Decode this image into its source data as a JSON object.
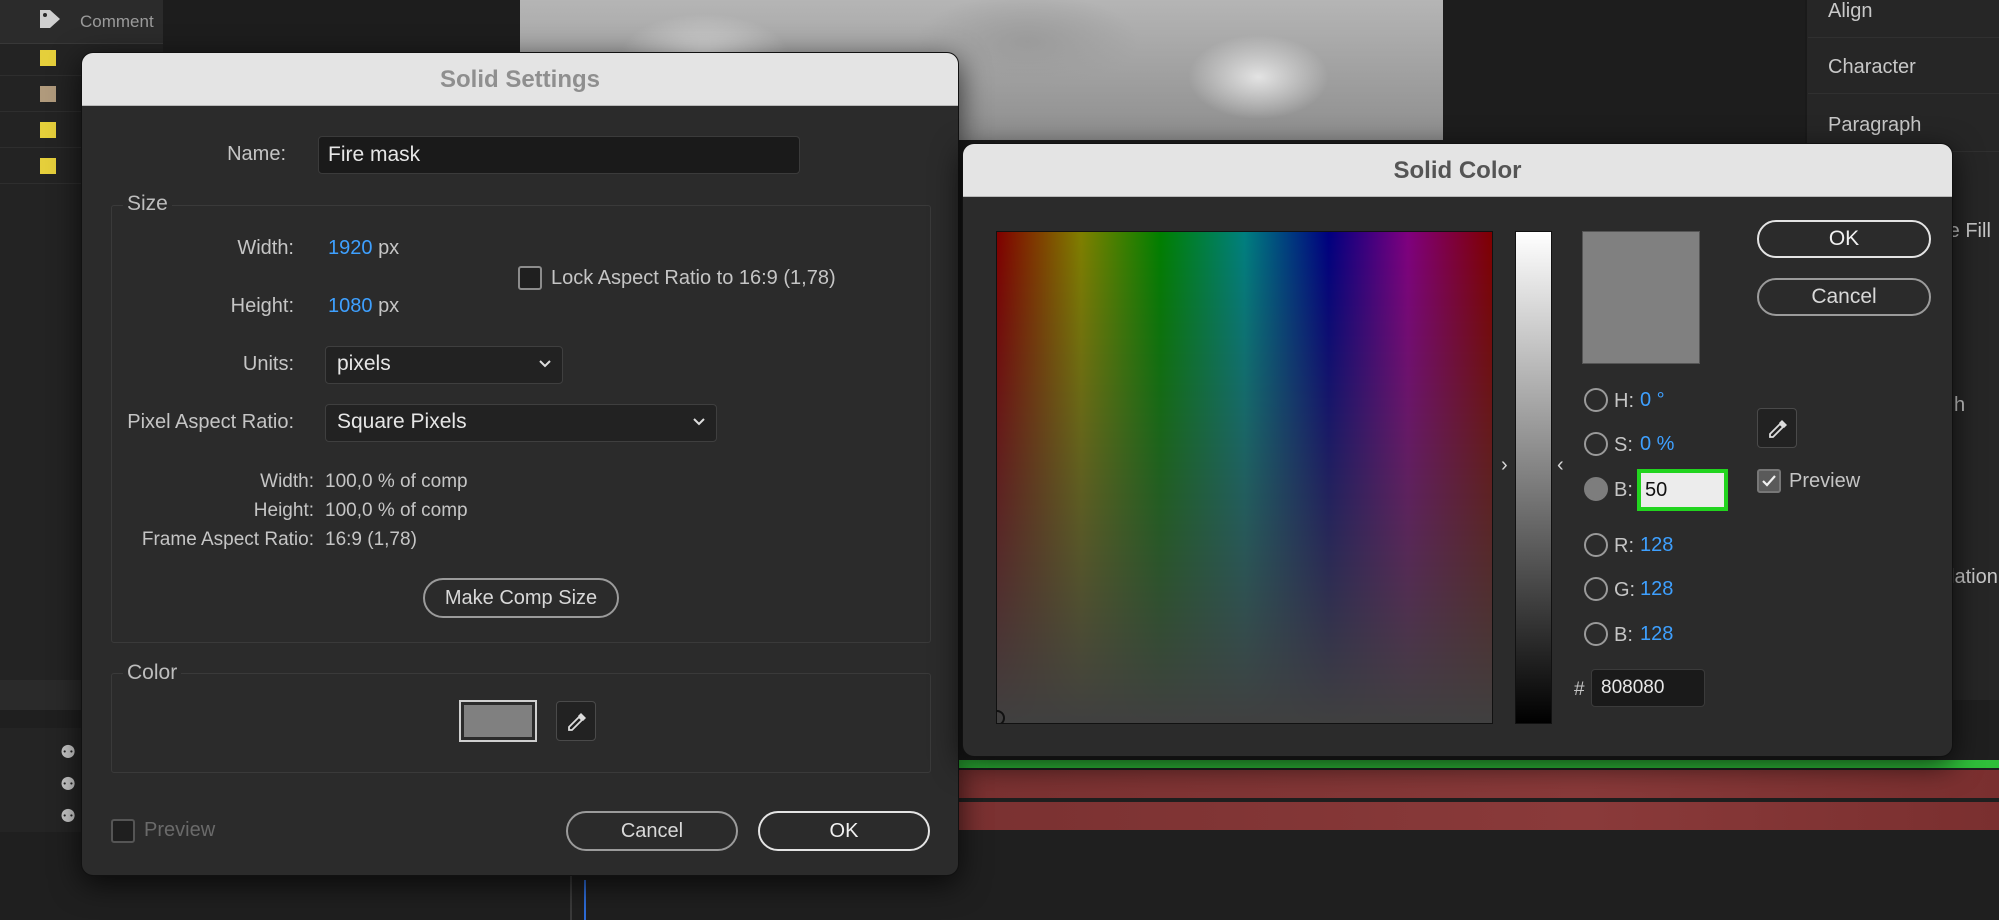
{
  "background": {
    "left_panel": {
      "header_label": "Comment",
      "label_colors": [
        "#e5cf3b",
        "#b09a7c",
        "#e5cf3b",
        "#e5cf3b"
      ]
    },
    "right_panel": {
      "items": [
        "Align",
        "Character",
        "Paragraph",
        "re Fill",
        "h",
        "lation"
      ]
    }
  },
  "solid_settings": {
    "title": "Solid Settings",
    "name_label": "Name:",
    "name_value": "Fire mask",
    "size_group": "Size",
    "width_label": "Width:",
    "width_value": "1920",
    "height_label": "Height:",
    "height_value": "1080",
    "unit_px": "px",
    "lock_aspect_label": "Lock Aspect Ratio to 16:9 (1,78)",
    "units_label": "Units:",
    "units_value": "pixels",
    "par_label": "Pixel Aspect Ratio:",
    "par_value": "Square Pixels",
    "info_width_label": "Width:",
    "info_width_value": "100,0 % of comp",
    "info_height_label": "Height:",
    "info_height_value": "100,0 % of comp",
    "frame_ar_label": "Frame Aspect Ratio:",
    "frame_ar_value": "16:9 (1,78)",
    "make_comp_size": "Make Comp Size",
    "color_group": "Color",
    "color_value": "#808080",
    "preview_label": "Preview",
    "cancel": "Cancel",
    "ok": "OK"
  },
  "solid_color": {
    "title": "Solid Color",
    "ok": "OK",
    "cancel": "Cancel",
    "h_label": "H:",
    "h_value": "0 °",
    "s_label": "S:",
    "s_value": "0 %",
    "b_label": "B:",
    "b_value": "50",
    "r_label": "R:",
    "r_value": "128",
    "g_label": "G:",
    "g_value": "128",
    "b2_label": "B:",
    "b2_value": "128",
    "hash": "#",
    "hex_value": "808080",
    "preview_label": "Preview",
    "preview_checked": true,
    "selected_mode": "B",
    "current_color": "#808080",
    "highlight_color": "#22d41f"
  }
}
